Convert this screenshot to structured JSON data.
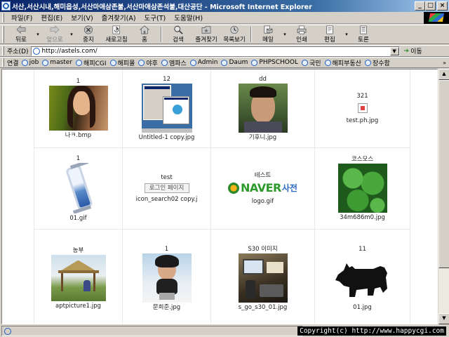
{
  "window": {
    "title": "서산,서산시내,해미읍성,서산마애삼존불,서산마애삼존석불,대산공단 - Microsoft Internet Explorer",
    "min_label": "_",
    "max_label": "□",
    "close_label": "×"
  },
  "menu": [
    "파일(F)",
    "편집(E)",
    "보기(V)",
    "즐겨찾기(A)",
    "도구(T)",
    "도움말(H)"
  ],
  "toolbar": {
    "back": "뒤로",
    "forward": "앞으로",
    "stop": "중지",
    "refresh": "새로고침",
    "home": "홈",
    "search": "검색",
    "favorites": "즐겨찾기",
    "history": "목록보기",
    "mail": "메일",
    "print": "인쇄",
    "edit": "편집",
    "discuss": "토론"
  },
  "address": {
    "label": "주소(D)",
    "url": "http://astels.com/",
    "go": "이동"
  },
  "links": {
    "label": "연결",
    "items": [
      "job",
      "master",
      "해피CGI",
      "해피몰",
      "야후",
      "엠파스",
      "Admin",
      "Daum",
      "PHPSCHOOL",
      "국민",
      "해피부동산",
      "장수함"
    ]
  },
  "gallery": [
    {
      "caption": "1",
      "filename": "나ㅋ.bmp",
      "thumb": "girl-portrait"
    },
    {
      "caption": "12",
      "filename": "Untitled-1 copy.jpg",
      "thumb": "desktop-screenshot"
    },
    {
      "caption": "dd",
      "filename": "기후니.jpg",
      "thumb": "man-portrait"
    },
    {
      "caption": "321",
      "filename": "test.ph.jpg",
      "thumb": "broken-image"
    },
    {
      "caption": "1",
      "filename": "01.gif",
      "thumb": "hourglass"
    },
    {
      "caption": "test",
      "filename": "icon_search02 copy.j",
      "thumb": "login-button",
      "thumb_text": "로그인 페이지"
    },
    {
      "caption": "테스트",
      "filename": "logo.gif",
      "thumb": "naver-logo",
      "thumb_text": "NAVER",
      "thumb_text2": "사전"
    },
    {
      "caption": "코스모스",
      "filename": "34m686m0.jpg",
      "thumb": "clover"
    },
    {
      "caption": "농부",
      "filename": "aptpicture1.jpg",
      "thumb": "hut"
    },
    {
      "caption": "1",
      "filename": "문희준.jpg",
      "thumb": "figure-doll"
    },
    {
      "caption": "S30 이미지",
      "filename": "s_go_s30_01.jpg",
      "thumb": "phone-desk"
    },
    {
      "caption": "11",
      "filename": "01.jpg",
      "thumb": "scottie-dog"
    }
  ],
  "status": {
    "copyright": "Copyright(c) http://www.happycgi.com"
  },
  "colors": {
    "titlebar_start": "#0a246a",
    "chrome": "#d4d0c8",
    "content_bg": "#ffffff"
  }
}
